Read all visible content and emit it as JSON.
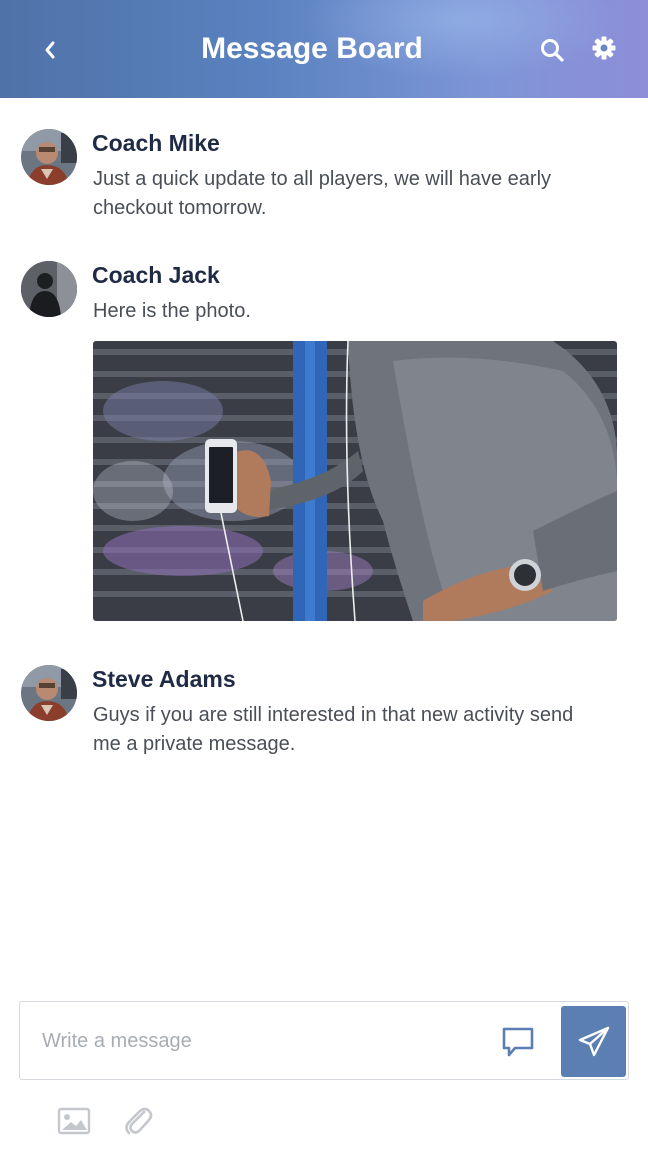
{
  "header": {
    "title": "Message Board",
    "back_icon": "chevron-left-icon",
    "search_icon": "search-icon",
    "settings_icon": "gear-icon",
    "gradient_colors": [
      "#4f72a8",
      "#7d95d6",
      "#8e8ed8"
    ]
  },
  "posts": [
    {
      "author": "Coach Mike",
      "text": "Just a quick update to all players, we will have early checkout tomorrow."
    },
    {
      "author": "Coach Jack",
      "text": "Here is the photo.",
      "has_photo": true
    },
    {
      "author": "Steve Adams",
      "text": "Guys if you are still interested in that new activity send me a private message."
    }
  ],
  "composer": {
    "placeholder": "Write a message",
    "value": "",
    "chat_icon": "speech-bubble-icon",
    "send_icon": "paper-plane-icon",
    "send_color": "#5b7fb2"
  },
  "attachments": {
    "image_icon": "image-icon",
    "clip_icon": "paperclip-icon"
  }
}
